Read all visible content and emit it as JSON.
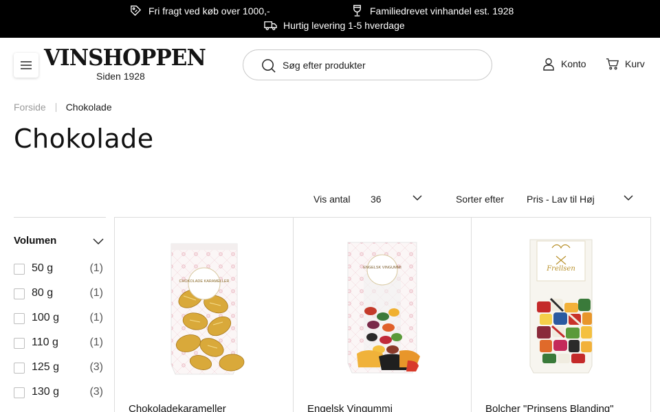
{
  "top_bar": {
    "messages": [
      {
        "icon": "free-shipping-tag-icon",
        "text": "Fri fragt ved køb over 1000,-"
      },
      {
        "icon": "wine-glass-icon",
        "text": "Familiedrevet vinhandel est. 1928"
      },
      {
        "icon": "delivery-truck-icon",
        "text": "Hurtig levering 1-5 hverdage"
      }
    ]
  },
  "header": {
    "menu_icon": "hamburger-menu-icon",
    "logo": {
      "wordmark": "VINSHOPPEN",
      "tagline": "Siden 1928"
    },
    "search": {
      "placeholder": "Søg efter produkter",
      "value": "",
      "icon": "search-icon"
    },
    "account": {
      "label": "Konto",
      "icon": "user-icon"
    },
    "cart": {
      "label": "Kurv",
      "icon": "shopping-cart-icon"
    }
  },
  "breadcrumb": {
    "home": "Forside",
    "current": "Chokolade"
  },
  "page": {
    "title": "Chokolade"
  },
  "controls": {
    "per_page": {
      "label": "Vis antal",
      "value": "36"
    },
    "sort": {
      "label": "Sorter efter",
      "value": "Pris - Lav til Høj"
    }
  },
  "filters": {
    "volume": {
      "title": "Volumen",
      "options": [
        {
          "label": "50 g",
          "count": "(1)"
        },
        {
          "label": "80 g",
          "count": "(1)"
        },
        {
          "label": "100 g",
          "count": "(1)"
        },
        {
          "label": "110 g",
          "count": "(1)"
        },
        {
          "label": "125 g",
          "count": "(3)"
        },
        {
          "label": "130 g",
          "count": "(3)"
        }
      ]
    }
  },
  "products": [
    {
      "name": "Chokoladekarameller",
      "bag_label": "CHOKOLADE KARAMELLER"
    },
    {
      "name": "Engelsk Vingummi",
      "bag_label": "ENGELSK VINGUMMI"
    },
    {
      "name": "Bolcher \"Prinsens Blanding\"",
      "bag_label": "Frellsen"
    }
  ],
  "colors": {
    "top_bar_bg": "#000000",
    "text": "#1a1a1a",
    "breadcrumb_muted": "#9a9a9a",
    "border": "#dcdcdc",
    "gold_wrapper": "#d9a93a",
    "bag_pattern": "#e8aab6"
  }
}
